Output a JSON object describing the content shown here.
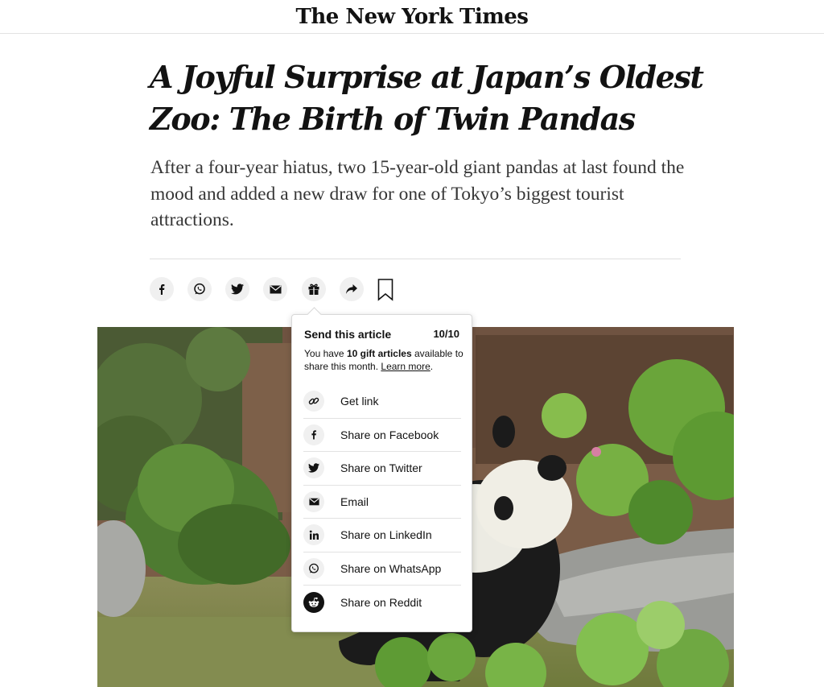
{
  "masthead": {
    "logo": "The New York Times"
  },
  "article": {
    "headline": "A Joyful Surprise at Japan’s Oldest Zoo: The Birth of Twin Pandas",
    "summary": "After a four-year hiatus, two 15-year-old giant pandas at last found the mood and added a new draw for one of Tokyo’s biggest tourist attractions."
  },
  "share_bar": {
    "buttons": [
      {
        "icon": "facebook-icon"
      },
      {
        "icon": "whatsapp-icon"
      },
      {
        "icon": "twitter-icon"
      },
      {
        "icon": "email-icon"
      },
      {
        "icon": "gift-icon"
      },
      {
        "icon": "share-arrow-icon"
      },
      {
        "icon": "bookmark-icon"
      }
    ]
  },
  "gift_popover": {
    "title": "Send this article",
    "count": "10/10",
    "desc_prefix": "You have ",
    "desc_bold": "10 gift articles",
    "desc_middle": " available to share this month. ",
    "learn_more": "Learn more",
    "desc_suffix": ".",
    "items": [
      {
        "label": "Get link",
        "icon": "link-icon"
      },
      {
        "label": "Share on Facebook",
        "icon": "facebook-icon"
      },
      {
        "label": "Share on Twitter",
        "icon": "twitter-icon"
      },
      {
        "label": "Email",
        "icon": "email-icon"
      },
      {
        "label": "Share on LinkedIn",
        "icon": "linkedin-icon"
      },
      {
        "label": "Share on WhatsApp",
        "icon": "whatsapp-icon"
      },
      {
        "label": "Share on Reddit",
        "icon": "reddit-icon"
      }
    ]
  },
  "colors": {
    "text": "#121212",
    "summary": "#363636",
    "button_bg": "#f0f0f0",
    "rule": "#dfdfdf"
  }
}
